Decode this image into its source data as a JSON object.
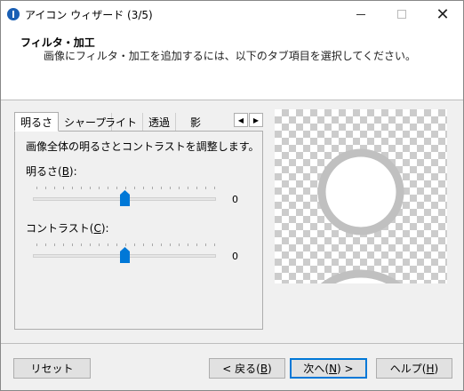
{
  "window": {
    "title": "アイコン ウィザード (3/5)",
    "close_glyph": "✕"
  },
  "header": {
    "title": "フィルタ・加工",
    "description": "画像にフィルタ・加工を追加するには、以下のタブ項目を選択してください。"
  },
  "tabs": [
    {
      "label": "明るさ",
      "active": true
    },
    {
      "label": "シャープ",
      "active": false
    },
    {
      "label": "ライト",
      "active": false
    },
    {
      "label": "透過",
      "active": false
    },
    {
      "label": "影",
      "active": false
    }
  ],
  "tab_scroll": {
    "left": "◀",
    "right": "▶"
  },
  "panel": {
    "description": "画像全体の明るさとコントラストを調整します。",
    "brightness": {
      "label": "明るさ(",
      "mnemonic": "B",
      "suffix": "):",
      "value": "0",
      "level": 0.5
    },
    "contrast": {
      "label": "コントラスト(",
      "mnemonic": "C",
      "suffix": "):",
      "value": "0",
      "level": 0.5
    }
  },
  "preview": {
    "icon": "user-silhouette-icon"
  },
  "buttons": {
    "reset": "リセット",
    "back_prefix": "< 戻る(",
    "back_mnemonic": "B",
    "back_suffix": ")",
    "next_prefix": "次へ(",
    "next_mnemonic": "N",
    "next_suffix": ") >",
    "help_prefix": "ヘルプ(",
    "help_mnemonic": "H",
    "help_suffix": ")"
  },
  "colors": {
    "accent": "#0078d7",
    "icon": "#1a5fb4",
    "avatar_stroke": "#c0c0c0"
  }
}
